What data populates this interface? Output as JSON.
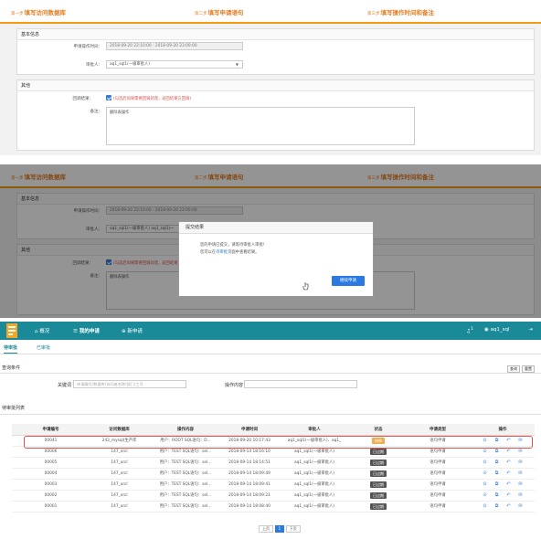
{
  "panel1": {
    "steps": [
      {
        "num": "第一步",
        "label": "填写访问数据库"
      },
      {
        "num": "第二步",
        "label": "填写申请语句"
      },
      {
        "num": "第三步",
        "label": "填写操作时间和备注"
      }
    ],
    "basic_section": "基本信息",
    "apply_time_label": "申请操作时间：",
    "apply_time_value": "2018-09-20 22:10:00 - 2018-09-20 23:00:00",
    "approver_label": "审批人：",
    "approver_value": "aq1_sql1(一级审批人)",
    "other_section": "其他",
    "result_label": "回调结果：",
    "result_note": "(勾选后如果需要回调处理，返回结果方回调)",
    "remark_label": "备注：",
    "remark_value": "删除表操作"
  },
  "panel2": {
    "apply_time_value": "2018-09-20 22:10:00 - 2018-09-20 23:00:00",
    "approver_value": "aq1_sql1(一级审批人) aq1_sql1(一",
    "dialog": {
      "title": "提交结果",
      "line1": "您的申请已提交，请等待审批人审批！",
      "line2_pre": "您可以在",
      "line2_link": "待审批",
      "line2_post": "页面中查看结果。",
      "button": "继续申请"
    }
  },
  "panel3": {
    "nav": {
      "overview": "概况",
      "my_apply": "我的申请",
      "new_apply": "新申请",
      "bell_count": "1",
      "user": "aq1_sql",
      "logout_icon": "logout-icon"
    },
    "subtabs": [
      "待审批",
      "已审批"
    ],
    "query": {
      "title": "查询条件",
      "keyword_label": "关键词",
      "keyword_placeholder": "申请编号/数据库/访问者名称/部门/工号",
      "content_label": "操作内容",
      "btn_search": "查询",
      "btn_reset": "重置"
    },
    "list_title": "待审批列表",
    "columns": [
      "申请编号",
      "访问数据库",
      "操作内容",
      "申请时间",
      "审批人",
      "状态",
      "申请类型",
      "操作"
    ],
    "rows": [
      {
        "id": "00041",
        "db": "243_mysql(生产库",
        "content": "用户：ROOT SQL语句：D...",
        "time": "2018-09-20 10:17:43",
        "approver": "aq1_sql1(一级审批人)、aq1_",
        "status": "待审",
        "status_color": "#f0ad4e",
        "type": "语句申请"
      },
      {
        "id": "00006",
        "db": "147_orcl",
        "content": "用户：TEST SQL语句：sel...",
        "time": "2018-09-14 18:16:10",
        "approver": "aq1_sql1(一级审批人)",
        "status": "已过期",
        "status_color": "#555555",
        "type": "语句申请"
      },
      {
        "id": "00005",
        "db": "147_orcl",
        "content": "用户：TEST SQL语句：sel...",
        "time": "2018-09-14 18:14:51",
        "approver": "aq1_sql1(一级审批人)",
        "status": "已过期",
        "status_color": "#555555",
        "type": "语句申请"
      },
      {
        "id": "00004",
        "db": "147_orcl",
        "content": "用户：TEST SQL语句：sel...",
        "time": "2018-09-14 18:09:49",
        "approver": "aq1_sql1(一级审批人)",
        "status": "已过期",
        "status_color": "#555555",
        "type": "语句申请"
      },
      {
        "id": "00003",
        "db": "147_orcl",
        "content": "用户：TEST SQL语句：sel...",
        "time": "2018-09-14 18:09:41",
        "approver": "aq1_sql1(一级审批人)",
        "status": "已过期",
        "status_color": "#555555",
        "type": "语句申请"
      },
      {
        "id": "00002",
        "db": "147_orcl",
        "content": "用户：TEST SQL语句：sel...",
        "time": "2018-09-14 18:09:21",
        "approver": "aq1_sql1(一级审批人)",
        "status": "已过期",
        "status_color": "#555555",
        "type": "语句申请"
      },
      {
        "id": "00001",
        "db": "147_orcl",
        "content": "用户：TEST SQL语句：sel...",
        "time": "2018-09-14 18:08:40",
        "approver": "aq1_sql1(一级审批人)",
        "status": "已过期",
        "status_color": "#555555",
        "type": "语句申请"
      }
    ],
    "actions": [
      "view-icon",
      "copy-icon",
      "undo-icon",
      "mail-icon"
    ],
    "pager": {
      "prev": "上页",
      "current": "1",
      "next": "下页"
    }
  },
  "colors": {
    "step_orange": "#e67e22",
    "topbar_teal": "#1b8a98",
    "link_blue": "#2a7ae2",
    "highlight_red": "#d9534f"
  }
}
